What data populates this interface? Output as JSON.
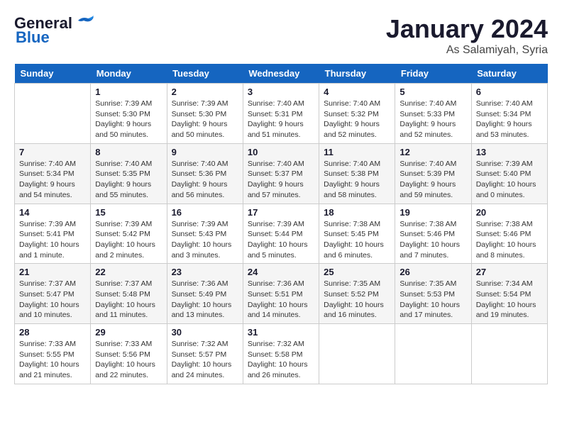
{
  "header": {
    "logo_general": "General",
    "logo_blue": "Blue",
    "month_title": "January 2024",
    "subtitle": "As Salamiyah, Syria"
  },
  "weekdays": [
    "Sunday",
    "Monday",
    "Tuesday",
    "Wednesday",
    "Thursday",
    "Friday",
    "Saturday"
  ],
  "weeks": [
    [
      {
        "day": "",
        "info": ""
      },
      {
        "day": "1",
        "info": "Sunrise: 7:39 AM\nSunset: 5:30 PM\nDaylight: 9 hours\nand 50 minutes."
      },
      {
        "day": "2",
        "info": "Sunrise: 7:39 AM\nSunset: 5:30 PM\nDaylight: 9 hours\nand 50 minutes."
      },
      {
        "day": "3",
        "info": "Sunrise: 7:40 AM\nSunset: 5:31 PM\nDaylight: 9 hours\nand 51 minutes."
      },
      {
        "day": "4",
        "info": "Sunrise: 7:40 AM\nSunset: 5:32 PM\nDaylight: 9 hours\nand 52 minutes."
      },
      {
        "day": "5",
        "info": "Sunrise: 7:40 AM\nSunset: 5:33 PM\nDaylight: 9 hours\nand 52 minutes."
      },
      {
        "day": "6",
        "info": "Sunrise: 7:40 AM\nSunset: 5:34 PM\nDaylight: 9 hours\nand 53 minutes."
      }
    ],
    [
      {
        "day": "7",
        "info": "Sunrise: 7:40 AM\nSunset: 5:34 PM\nDaylight: 9 hours\nand 54 minutes."
      },
      {
        "day": "8",
        "info": "Sunrise: 7:40 AM\nSunset: 5:35 PM\nDaylight: 9 hours\nand 55 minutes."
      },
      {
        "day": "9",
        "info": "Sunrise: 7:40 AM\nSunset: 5:36 PM\nDaylight: 9 hours\nand 56 minutes."
      },
      {
        "day": "10",
        "info": "Sunrise: 7:40 AM\nSunset: 5:37 PM\nDaylight: 9 hours\nand 57 minutes."
      },
      {
        "day": "11",
        "info": "Sunrise: 7:40 AM\nSunset: 5:38 PM\nDaylight: 9 hours\nand 58 minutes."
      },
      {
        "day": "12",
        "info": "Sunrise: 7:40 AM\nSunset: 5:39 PM\nDaylight: 9 hours\nand 59 minutes."
      },
      {
        "day": "13",
        "info": "Sunrise: 7:39 AM\nSunset: 5:40 PM\nDaylight: 10 hours\nand 0 minutes."
      }
    ],
    [
      {
        "day": "14",
        "info": "Sunrise: 7:39 AM\nSunset: 5:41 PM\nDaylight: 10 hours\nand 1 minute."
      },
      {
        "day": "15",
        "info": "Sunrise: 7:39 AM\nSunset: 5:42 PM\nDaylight: 10 hours\nand 2 minutes."
      },
      {
        "day": "16",
        "info": "Sunrise: 7:39 AM\nSunset: 5:43 PM\nDaylight: 10 hours\nand 3 minutes."
      },
      {
        "day": "17",
        "info": "Sunrise: 7:39 AM\nSunset: 5:44 PM\nDaylight: 10 hours\nand 5 minutes."
      },
      {
        "day": "18",
        "info": "Sunrise: 7:38 AM\nSunset: 5:45 PM\nDaylight: 10 hours\nand 6 minutes."
      },
      {
        "day": "19",
        "info": "Sunrise: 7:38 AM\nSunset: 5:46 PM\nDaylight: 10 hours\nand 7 minutes."
      },
      {
        "day": "20",
        "info": "Sunrise: 7:38 AM\nSunset: 5:46 PM\nDaylight: 10 hours\nand 8 minutes."
      }
    ],
    [
      {
        "day": "21",
        "info": "Sunrise: 7:37 AM\nSunset: 5:47 PM\nDaylight: 10 hours\nand 10 minutes."
      },
      {
        "day": "22",
        "info": "Sunrise: 7:37 AM\nSunset: 5:48 PM\nDaylight: 10 hours\nand 11 minutes."
      },
      {
        "day": "23",
        "info": "Sunrise: 7:36 AM\nSunset: 5:49 PM\nDaylight: 10 hours\nand 13 minutes."
      },
      {
        "day": "24",
        "info": "Sunrise: 7:36 AM\nSunset: 5:51 PM\nDaylight: 10 hours\nand 14 minutes."
      },
      {
        "day": "25",
        "info": "Sunrise: 7:35 AM\nSunset: 5:52 PM\nDaylight: 10 hours\nand 16 minutes."
      },
      {
        "day": "26",
        "info": "Sunrise: 7:35 AM\nSunset: 5:53 PM\nDaylight: 10 hours\nand 17 minutes."
      },
      {
        "day": "27",
        "info": "Sunrise: 7:34 AM\nSunset: 5:54 PM\nDaylight: 10 hours\nand 19 minutes."
      }
    ],
    [
      {
        "day": "28",
        "info": "Sunrise: 7:33 AM\nSunset: 5:55 PM\nDaylight: 10 hours\nand 21 minutes."
      },
      {
        "day": "29",
        "info": "Sunrise: 7:33 AM\nSunset: 5:56 PM\nDaylight: 10 hours\nand 22 minutes."
      },
      {
        "day": "30",
        "info": "Sunrise: 7:32 AM\nSunset: 5:57 PM\nDaylight: 10 hours\nand 24 minutes."
      },
      {
        "day": "31",
        "info": "Sunrise: 7:32 AM\nSunset: 5:58 PM\nDaylight: 10 hours\nand 26 minutes."
      },
      {
        "day": "",
        "info": ""
      },
      {
        "day": "",
        "info": ""
      },
      {
        "day": "",
        "info": ""
      }
    ]
  ]
}
